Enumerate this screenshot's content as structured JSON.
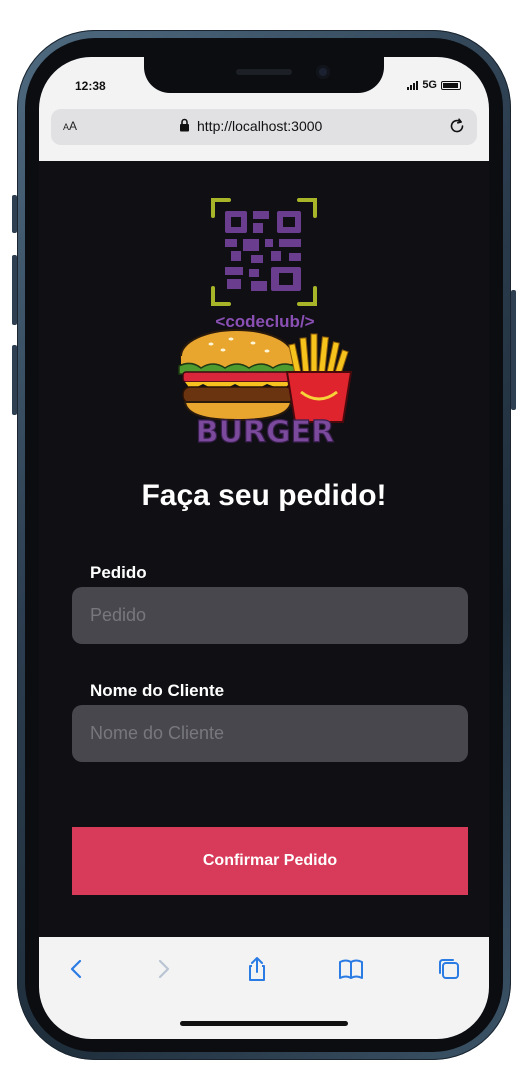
{
  "status_bar": {
    "time": "12:38",
    "network": "5G"
  },
  "browser": {
    "text_size_label_small": "A",
    "text_size_label_large": "A",
    "url": "http://localhost:3000",
    "lock_icon": "lock-icon",
    "reload_icon": "reload-icon"
  },
  "logo": {
    "brand_text": "<codeclub/>",
    "burger_text": "BURGER",
    "colors": {
      "qr": "#6b3d8f",
      "frame": "#a8b529",
      "brand": "#8a4fb3"
    }
  },
  "form": {
    "title": "Faça seu pedido!",
    "order_label": "Pedido",
    "order_placeholder": "Pedido",
    "order_value": "",
    "client_label": "Nome do Cliente",
    "client_placeholder": "Nome do Cliente",
    "client_value": "",
    "submit_label": "Confirmar Pedido"
  },
  "toolbar": {
    "items": [
      "back-icon",
      "forward-icon",
      "share-icon",
      "bookmarks-icon",
      "tabs-icon"
    ]
  },
  "colors": {
    "background": "#0f0f14",
    "input_bg": "#47474d",
    "accent": "#d83a59",
    "toolbar_icon": "#2a7be4"
  }
}
